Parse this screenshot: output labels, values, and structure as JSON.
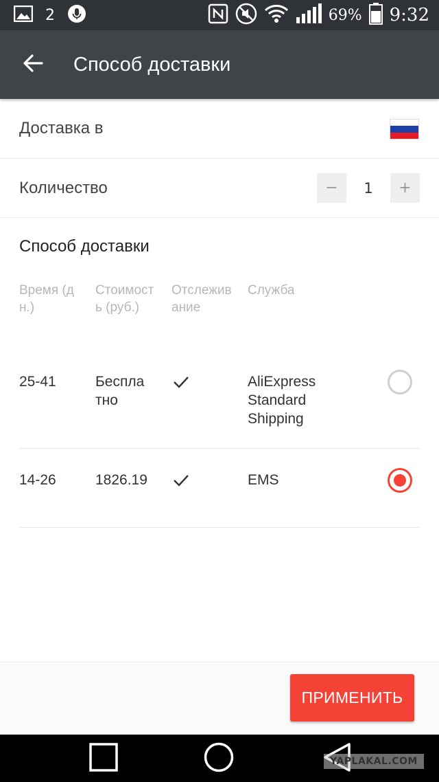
{
  "status_bar": {
    "notification_count": "2",
    "battery_percent": "69%",
    "time": "9:32",
    "icons": [
      "image-icon",
      "mic-icon",
      "nfc-icon",
      "mute-icon",
      "wifi-icon",
      "signal-icon",
      "battery-icon"
    ]
  },
  "app_bar": {
    "title": "Способ доставки"
  },
  "delivery_to": {
    "label": "Доставка в",
    "flag_colors": [
      "#ffffff",
      "#1c3fa8",
      "#e11d26"
    ]
  },
  "quantity": {
    "label": "Количество",
    "value": "1",
    "minus": "−",
    "plus": "+"
  },
  "shipping": {
    "section_title": "Способ доставки",
    "columns": {
      "time": "Время (дн.)",
      "cost": "Стоимость (руб.)",
      "tracking": "Отслеживание",
      "service": "Служба"
    },
    "options": [
      {
        "time": "25-41",
        "cost": "Бесплатно",
        "tracking": true,
        "service": "AliExpress Standard Shipping",
        "selected": false
      },
      {
        "time": "14-26",
        "cost": "1826.19",
        "tracking": true,
        "service": "EMS",
        "selected": true
      }
    ]
  },
  "footer": {
    "apply_label": "ПРИМЕНИТЬ"
  },
  "watermark": "YAPLAKAL.COM",
  "colors": {
    "accent": "#f44336",
    "app_bar": "#3f4448",
    "status_bar": "#2f3236"
  }
}
